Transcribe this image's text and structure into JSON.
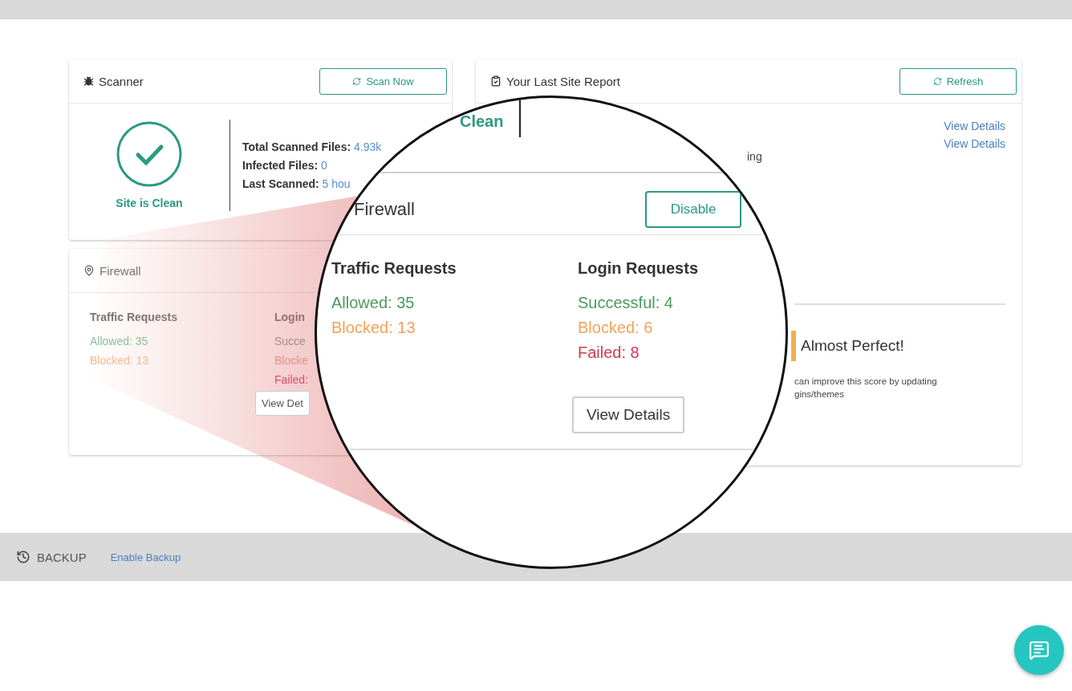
{
  "scanner": {
    "title": "Scanner",
    "button": "Scan Now",
    "status": "Site is Clean",
    "stats": [
      {
        "label": "Total Scanned Files:",
        "value": "4.93k"
      },
      {
        "label": "Infected Files:",
        "value": "0"
      },
      {
        "label": "Last Scanned:",
        "value": "5 hou"
      }
    ]
  },
  "firewall": {
    "title": "Firewall",
    "columns": [
      {
        "heading": "Traffic Requests",
        "stats": [
          {
            "text": "Allowed: 35",
            "color": "#8fbf95"
          },
          {
            "text": "Blocked: 13",
            "color": "#f5b990"
          }
        ]
      },
      {
        "heading": "Login",
        "stats": [
          {
            "text": "Succe",
            "color": "#a58a8a"
          },
          {
            "text": "Blocke",
            "color": "#ea9080"
          },
          {
            "text": "Failed:",
            "color": "#d8506a"
          }
        ]
      }
    ],
    "button": "View Det"
  },
  "site_report": {
    "title": "Your Last Site Report",
    "button": "Refresh",
    "links": [
      "View Details",
      "View Details"
    ],
    "fragment": "ing",
    "score": "Almost Perfect!",
    "note": "can improve this score by updating\ngins/themes"
  },
  "magnifier": {
    "fragment": "Clean",
    "title": "Firewall",
    "button": "Disable",
    "columns": [
      {
        "heading": "Traffic Requests",
        "stats": [
          {
            "text": "Allowed: 35",
            "color": "#4c9a5c"
          },
          {
            "text": "Blocked: 13",
            "color": "#f0a35a"
          }
        ]
      },
      {
        "heading": "Login Requests",
        "stats": [
          {
            "text": "Successful: 4",
            "color": "#4c9a5c"
          },
          {
            "text": "Blocked: 6",
            "color": "#f0a35a"
          },
          {
            "text": "Failed: 8",
            "color": "#d23a4e"
          }
        ]
      }
    ],
    "details": "View Details"
  },
  "backup": {
    "label": "BACKUP",
    "link": "Enable Backup"
  }
}
